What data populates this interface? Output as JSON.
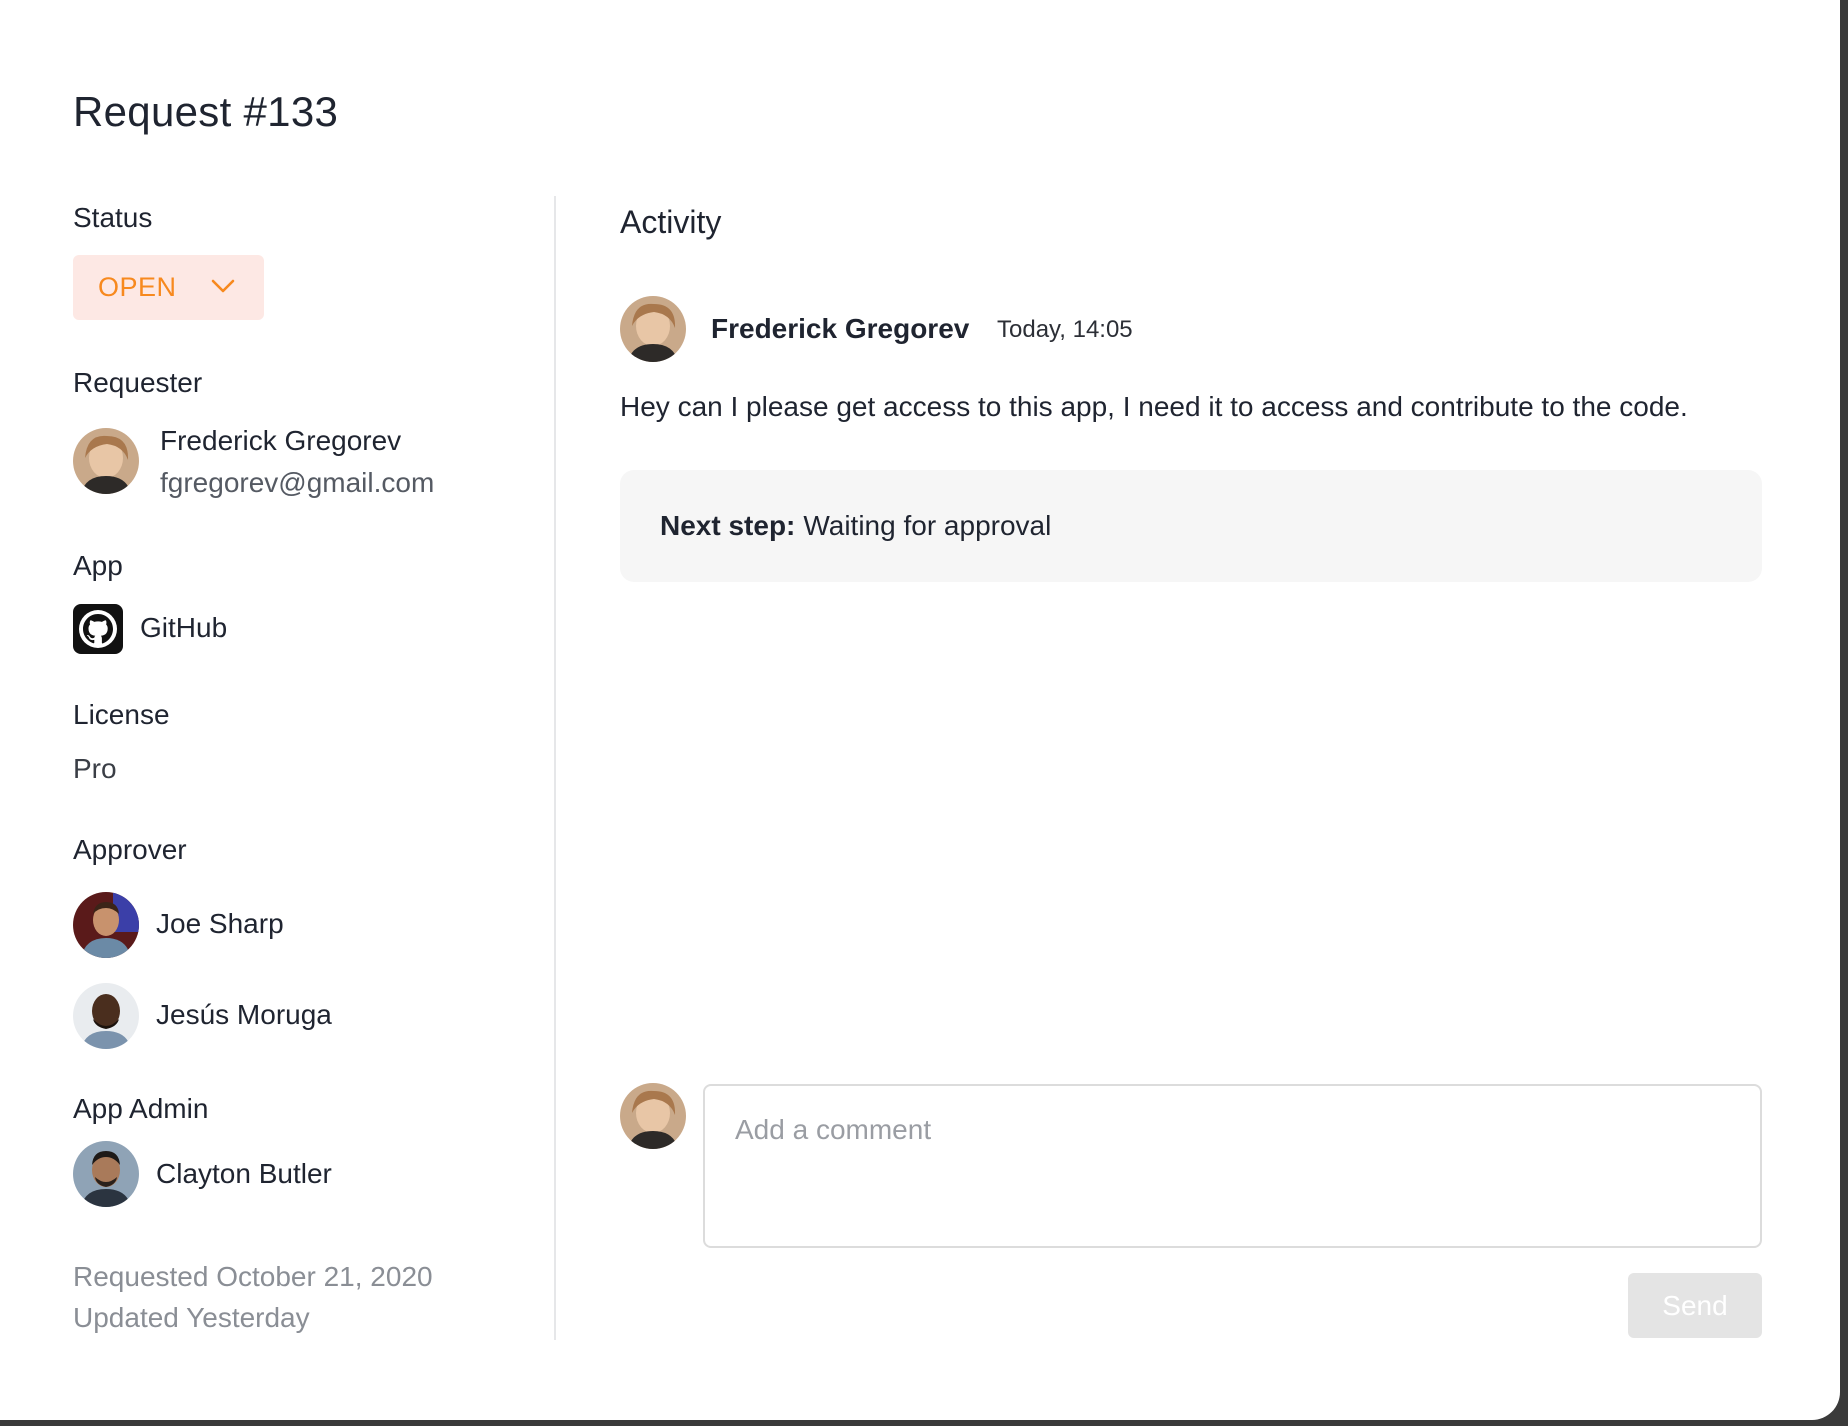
{
  "title": "Request #133",
  "status": {
    "label": "Status",
    "value": "OPEN"
  },
  "requester": {
    "label": "Requester",
    "name": "Frederick Gregorev",
    "email": "fgregorev@gmail.com"
  },
  "app": {
    "label": "App",
    "name": "GitHub",
    "icon": "github-icon"
  },
  "license": {
    "label": "License",
    "value": "Pro"
  },
  "approver": {
    "label": "Approver",
    "people": [
      {
        "name": "Joe Sharp"
      },
      {
        "name": "Jesús Moruga"
      }
    ]
  },
  "app_admin": {
    "label": "App Admin",
    "name": "Clayton Butler"
  },
  "meta": {
    "requested": "Requested October 21, 2020",
    "updated": "Updated Yesterday"
  },
  "activity": {
    "title": "Activity",
    "message": {
      "author": "Frederick Gregorev",
      "time": "Today, 14:05",
      "body": "Hey can I please get access to this app, I need it to access and contribute to the code."
    },
    "next_step": {
      "label": "Next step:",
      "value": "Waiting for approval"
    }
  },
  "comment": {
    "placeholder": "Add a comment",
    "send_label": "Send"
  },
  "colors": {
    "status_text": "#f7891e",
    "status_bg": "#fde8e4",
    "send_disabled_bg": "#e4e4e4"
  }
}
